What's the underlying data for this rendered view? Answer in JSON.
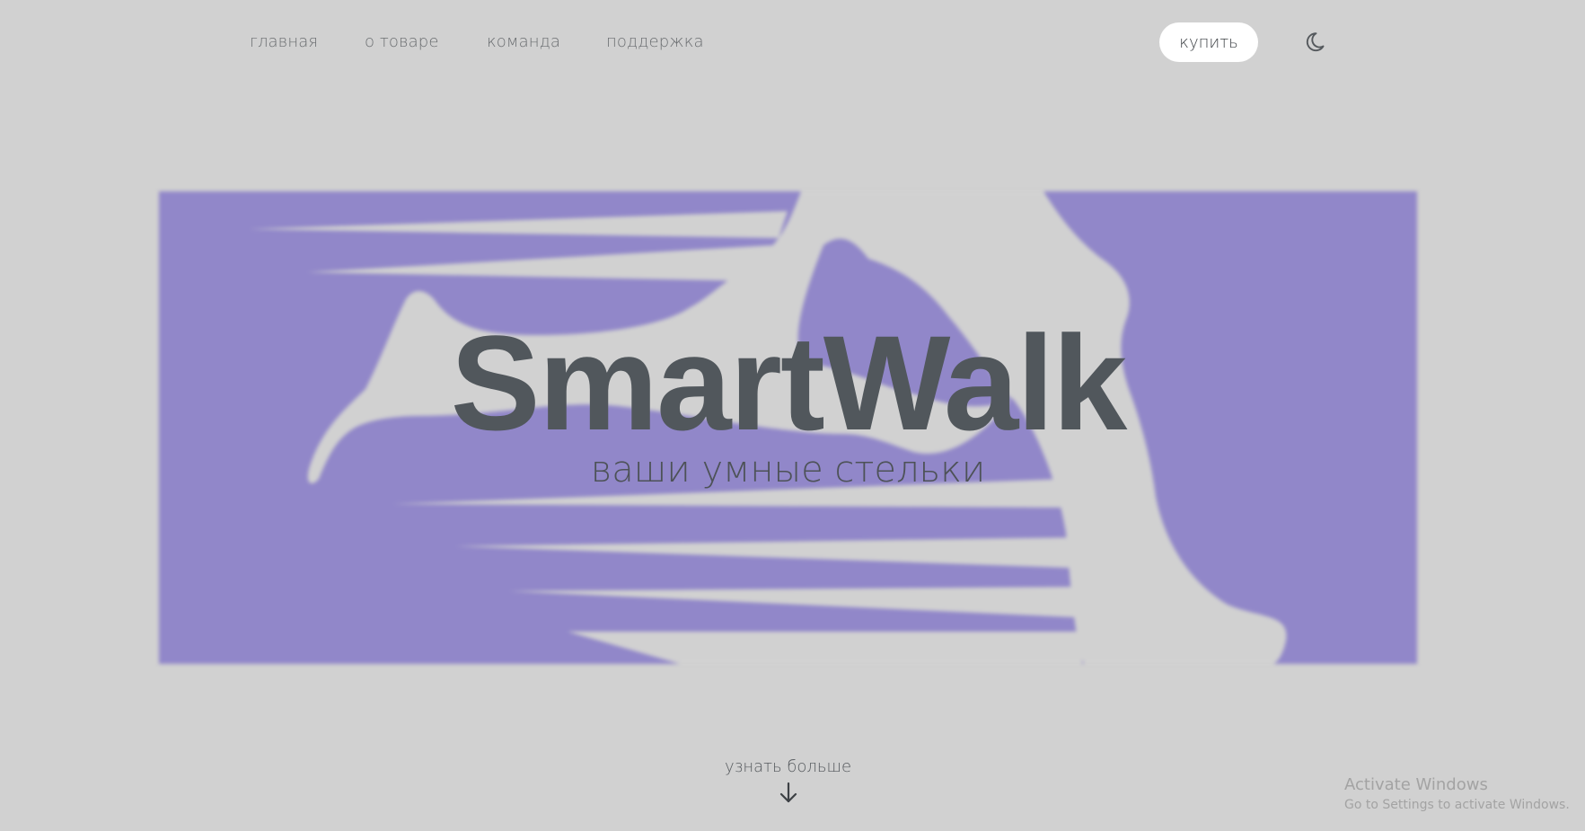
{
  "nav": {
    "items": [
      {
        "label": "главная"
      },
      {
        "label": "о товаре"
      },
      {
        "label": "команда"
      },
      {
        "label": "поддержка"
      }
    ],
    "buy_label": "купить",
    "theme_icon": "moon-icon"
  },
  "hero": {
    "title": "SmartWalk",
    "subtitle": "ваши умные стельки",
    "accent_color": "#9187c9",
    "background_color": "#d1d1d1",
    "text_color": "#51575c"
  },
  "learn_more": {
    "label": "узнать больше",
    "icon": "arrow-down-icon"
  },
  "watermark": {
    "title": "Activate Windows",
    "subtitle": "Go to Settings to activate Windows."
  }
}
